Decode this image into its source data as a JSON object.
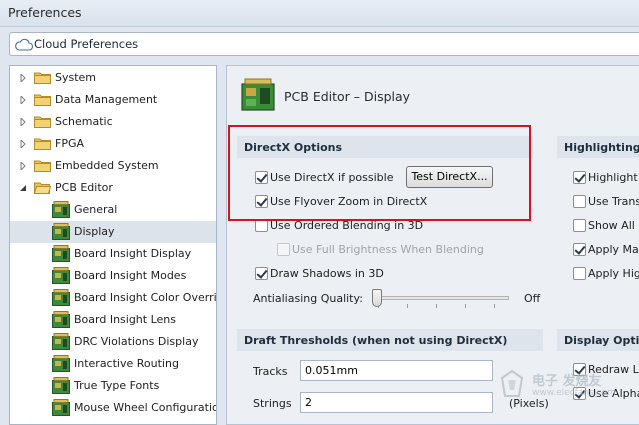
{
  "window": {
    "title": "Preferences"
  },
  "cloud": {
    "label": "Cloud Preferences"
  },
  "tree": {
    "items": [
      {
        "label": "System",
        "kind": "folder",
        "expander": "collapsed"
      },
      {
        "label": "Data Management",
        "kind": "folder",
        "expander": "collapsed"
      },
      {
        "label": "Schematic",
        "kind": "folder",
        "expander": "collapsed"
      },
      {
        "label": "FPGA",
        "kind": "folder",
        "expander": "collapsed"
      },
      {
        "label": "Embedded System",
        "kind": "folder",
        "expander": "collapsed"
      },
      {
        "label": "PCB Editor",
        "kind": "folder-open",
        "expander": "expanded"
      },
      {
        "label": "General",
        "kind": "page"
      },
      {
        "label": "Display",
        "kind": "page",
        "selected": true
      },
      {
        "label": "Board Insight Display",
        "kind": "page"
      },
      {
        "label": "Board Insight Modes",
        "kind": "page"
      },
      {
        "label": "Board Insight Color Overrid",
        "kind": "page"
      },
      {
        "label": "Board Insight Lens",
        "kind": "page"
      },
      {
        "label": "DRC Violations Display",
        "kind": "page"
      },
      {
        "label": "Interactive Routing",
        "kind": "page"
      },
      {
        "label": "True Type Fonts",
        "kind": "page"
      },
      {
        "label": "Mouse Wheel Configuration",
        "kind": "page"
      }
    ]
  },
  "page": {
    "title": "PCB Editor – Display"
  },
  "directx": {
    "header": "DirectX Options",
    "use_directx": {
      "label": "Use DirectX if possible",
      "checked": true
    },
    "test_button": "Test DirectX...",
    "flyover": {
      "label": "Use Flyover Zoom in DirectX",
      "checked": true
    },
    "ordered_blending": {
      "label": "Use Ordered Blending in 3D",
      "checked": false
    },
    "full_brightness": {
      "label": "Use Full Brightness When Blending",
      "checked": false,
      "disabled": true
    },
    "draw_shadows": {
      "label": "Draw Shadows in 3D",
      "checked": true
    },
    "antialiasing": {
      "label": "Antialiasing Quality:",
      "value_label": "Off",
      "level": 0
    }
  },
  "draft": {
    "header": "Draft Thresholds (when not using DirectX)",
    "tracks": {
      "label": "Tracks",
      "value": "0.051mm"
    },
    "strings": {
      "label": "Strings",
      "value": "2",
      "unit": "(Pixels)"
    }
  },
  "highlighting": {
    "header": "Highlighting O",
    "items": [
      {
        "label": "Highlight",
        "checked": true
      },
      {
        "label": "Use Transp",
        "checked": false
      },
      {
        "label": "Show All P",
        "checked": false
      },
      {
        "label": "Apply Mas",
        "checked": true
      },
      {
        "label": "Apply Hig",
        "checked": false
      }
    ]
  },
  "display_options": {
    "header": "Display Option",
    "items": [
      {
        "label": "Redraw La",
        "checked": true
      },
      {
        "label": "Use Alpha",
        "checked": true
      }
    ]
  },
  "watermark": {
    "text_top": "电子   发烧友",
    "text_bottom": "www.elecfans.com"
  },
  "colors": {
    "highlight_box": "#d6121b",
    "selection": "#dce3ea",
    "panel_header": "#dde4ec"
  }
}
